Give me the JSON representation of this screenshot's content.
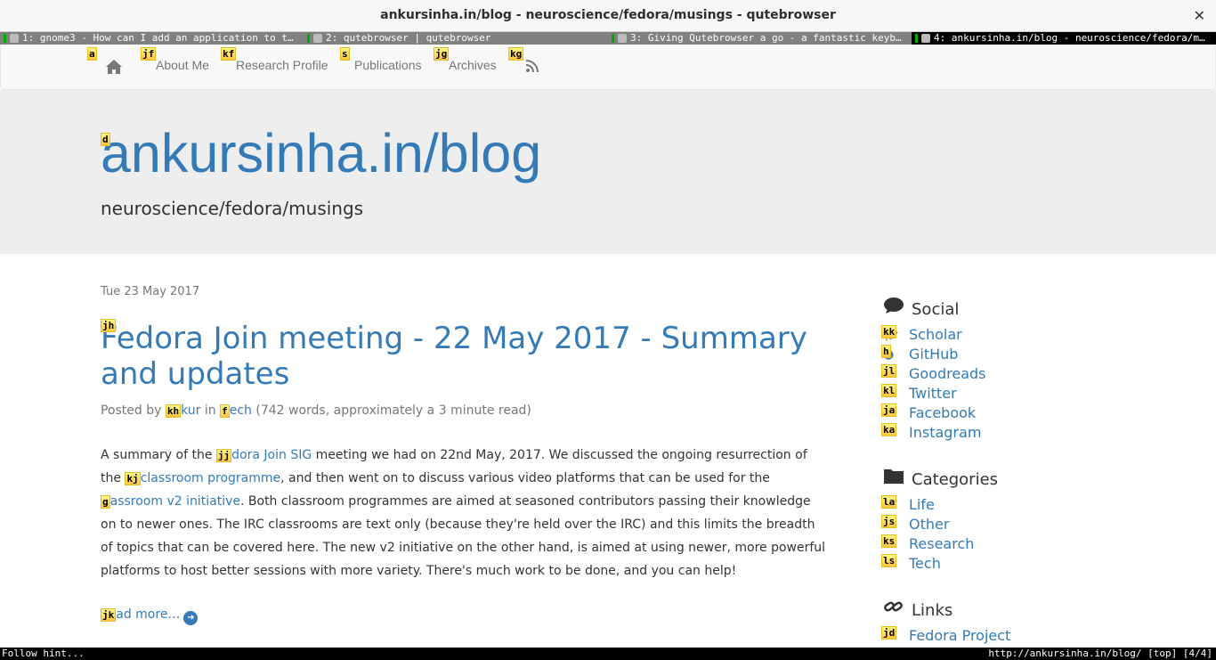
{
  "window": {
    "title": "ankursinha.in/blog - neuroscience/fedora/musings - qutebrowser",
    "close": "✕"
  },
  "tabs": [
    {
      "label": "1: gnome3 - How can I add an application to t…"
    },
    {
      "label": "2: qutebrowser | qutebrowser"
    },
    {
      "label": "3: Giving Qutebrowser a go - a fantastic keyb…"
    },
    {
      "label": "4: ankursinha.in/blog - neuroscience/fedora/m…"
    }
  ],
  "nav": {
    "items": [
      {
        "label": "About Me",
        "hint": "jf"
      },
      {
        "label": "Research Profile",
        "hint": "kf"
      },
      {
        "label": "Publications",
        "hint": "s"
      },
      {
        "label": "Archives",
        "hint": "jg"
      }
    ],
    "home_hint": "a",
    "rss_hint": "kg"
  },
  "header": {
    "title": "ankursinha.in/blog",
    "subtitle": "neuroscience/fedora/musings",
    "title_hint": "d"
  },
  "post": {
    "date": "Tue 23 May 2017",
    "title": "Fedora Join meeting - 22 May 2017 - Summary and updates",
    "title_hint": "jh",
    "meta_prefix": "Posted by ",
    "author_tail": "kur",
    "author_hint": "kh",
    "meta_in": " in ",
    "category_tail": "ech",
    "category_hint": "f",
    "meta_suffix": " (742 words, approximately a 3 minute read)",
    "s1": "A summary of the ",
    "l1_hint": "jj",
    "l1_tail": "dora Join SIG",
    "s2": " meeting we had on 22nd May, 2017. We discussed the ongoing resurrection of the ",
    "l2_hint": "kj",
    "l2_tail": "classroom programme",
    "s3": ", and then went on to discuss various video platforms that can be used for the ",
    "l3_hint": "g",
    "l3_tail": "assroom v2 initiative",
    "s4": ". Both classroom programmes are aimed at seasoned contributors passing their knowledge on to newer ones. The IRC classrooms are text only (because they're held over the IRC) and this limits the breadth of topics that can be covered here. The new v2 initiative on the other hand, is aimed at using newer, more powerful platforms to host better sessions with more variety. There's much work to be done, and you can help!",
    "readmore_hint": "jk",
    "readmore_tail": "ad more…"
  },
  "sidebar": {
    "social": {
      "heading": "Social",
      "items": [
        {
          "label": "Scholar",
          "hint": "kk"
        },
        {
          "label": "GitHub",
          "hint": "h"
        },
        {
          "label": "Goodreads",
          "hint": "jl"
        },
        {
          "label": "Twitter",
          "hint": "kl"
        },
        {
          "label": "Facebook",
          "hint": "ja"
        },
        {
          "label": "Instagram",
          "hint": "ka"
        }
      ]
    },
    "categories": {
      "heading": "Categories",
      "items": [
        {
          "label": "Life",
          "hint": "la"
        },
        {
          "label": "Other",
          "hint": "js"
        },
        {
          "label": "Research",
          "hint": "ks"
        },
        {
          "label": "Tech",
          "hint": "ls"
        }
      ]
    },
    "links": {
      "heading": "Links",
      "items": [
        {
          "label": "Fedora Project",
          "hint": "jd"
        }
      ]
    }
  },
  "status": {
    "left": "Follow hint...",
    "right": "http://ankursinha.in/blog/ [top] [4/4]"
  }
}
